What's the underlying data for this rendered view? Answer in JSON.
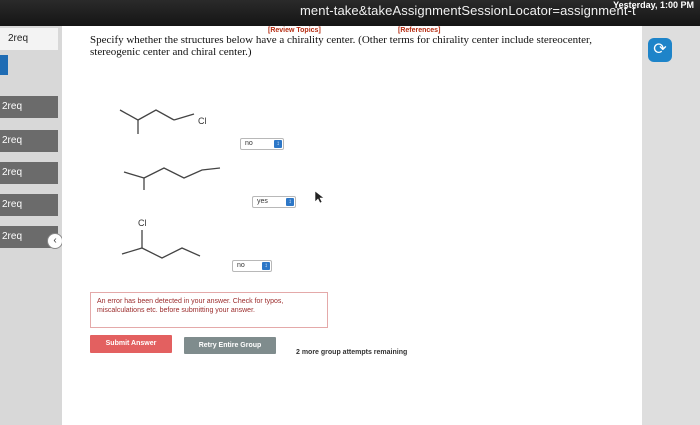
{
  "browser": {
    "url_fragment": "ment-take&takeAssignmentSessionLocator=assignment-t",
    "time": "Yesterday, 1:00 PM"
  },
  "sidebar": {
    "items": [
      {
        "label": "2req"
      },
      {
        "label": "2req"
      },
      {
        "label": "2req"
      },
      {
        "label": "2req"
      },
      {
        "label": "2req"
      },
      {
        "label": "2req"
      }
    ],
    "collapse_icon": "chevron-left-icon"
  },
  "header": {
    "review_topics": "[Review Topics]",
    "references": "[References]"
  },
  "question": {
    "text": "Specify whether the structures below have a chirality center. (Other terms for chirality center include stereocenter, stereogenic center and chiral center.)"
  },
  "molecules": [
    {
      "label": "Cl",
      "answer": "no"
    },
    {
      "label": "",
      "answer": "yes"
    },
    {
      "label": "Cl",
      "answer": "no"
    }
  ],
  "error_message": "An error has been detected in your answer. Check for typos, miscalculations etc. before submitting your answer.",
  "actions": {
    "submit_label": "Submit Answer",
    "retry_label": "Retry Entire Group",
    "attempts_text": "2 more group attempts remaining"
  },
  "colors": {
    "submit": "#e36060",
    "retry": "#7f8c8d",
    "select_arrow": "#2d77c7",
    "sidebar_active": "#1f6cb4",
    "link": "#b52c12"
  }
}
